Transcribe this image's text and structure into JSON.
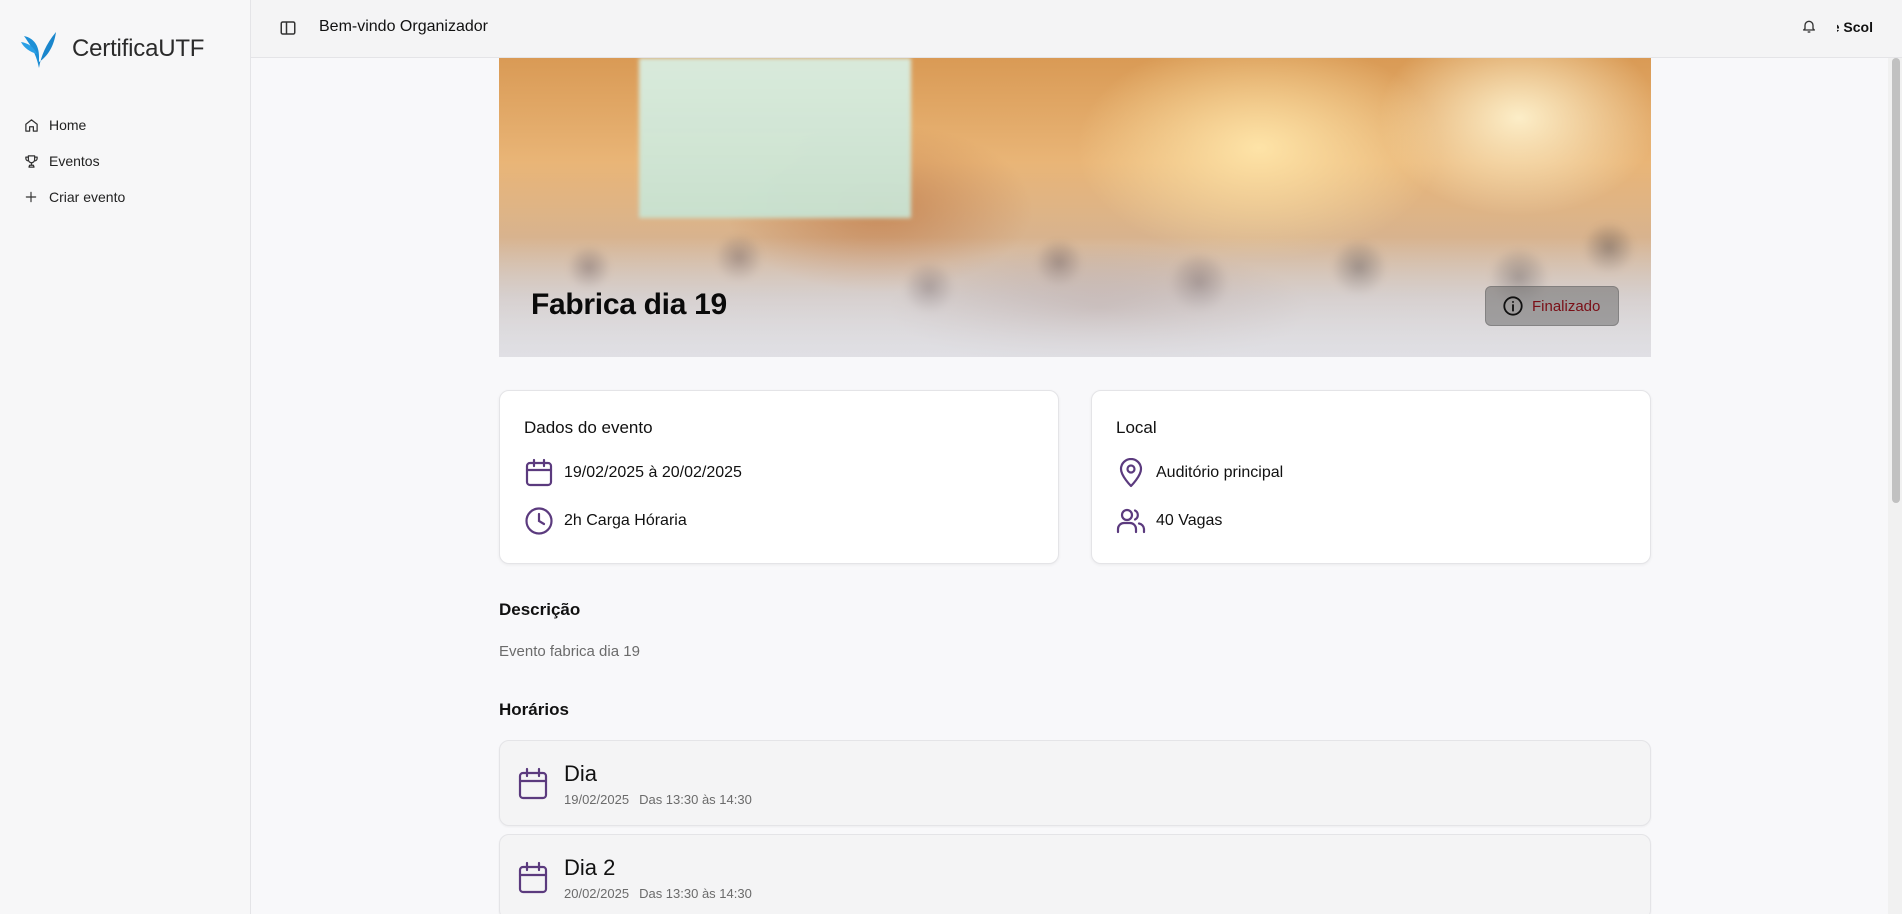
{
  "brand": {
    "name": "CertificaUTF",
    "logo": "butterfly-logo"
  },
  "sidebar": {
    "items": [
      {
        "label": "Home",
        "icon": "home-icon"
      },
      {
        "label": "Eventos",
        "icon": "trophy-icon"
      },
      {
        "label": "Criar evento",
        "icon": "plus-icon"
      }
    ]
  },
  "header": {
    "welcome": "Bem-vindo Organizador",
    "user": "ue Scol"
  },
  "event": {
    "title": "Fabrica dia 19",
    "status": "Finalizado"
  },
  "details": {
    "title": "Dados do evento",
    "dates": "19/02/2025 à 20/02/2025",
    "workload": "2h Carga Hóraria"
  },
  "location": {
    "title": "Local",
    "place": "Auditório principal",
    "spots": "40 Vagas"
  },
  "description": {
    "title": "Descrição",
    "text": "Evento fabrica dia 19"
  },
  "schedule": {
    "title": "Horários",
    "items": [
      {
        "name": "Dia",
        "date": "19/02/2025",
        "time": "Das 13:30 às 14:30"
      },
      {
        "name": "Dia 2",
        "date": "20/02/2025",
        "time": "Das 13:30 às 14:30"
      }
    ]
  },
  "colors": {
    "accent": "#5b3a7e",
    "brand_blue": "#1d8fd6",
    "status_text": "#7a0f17"
  }
}
